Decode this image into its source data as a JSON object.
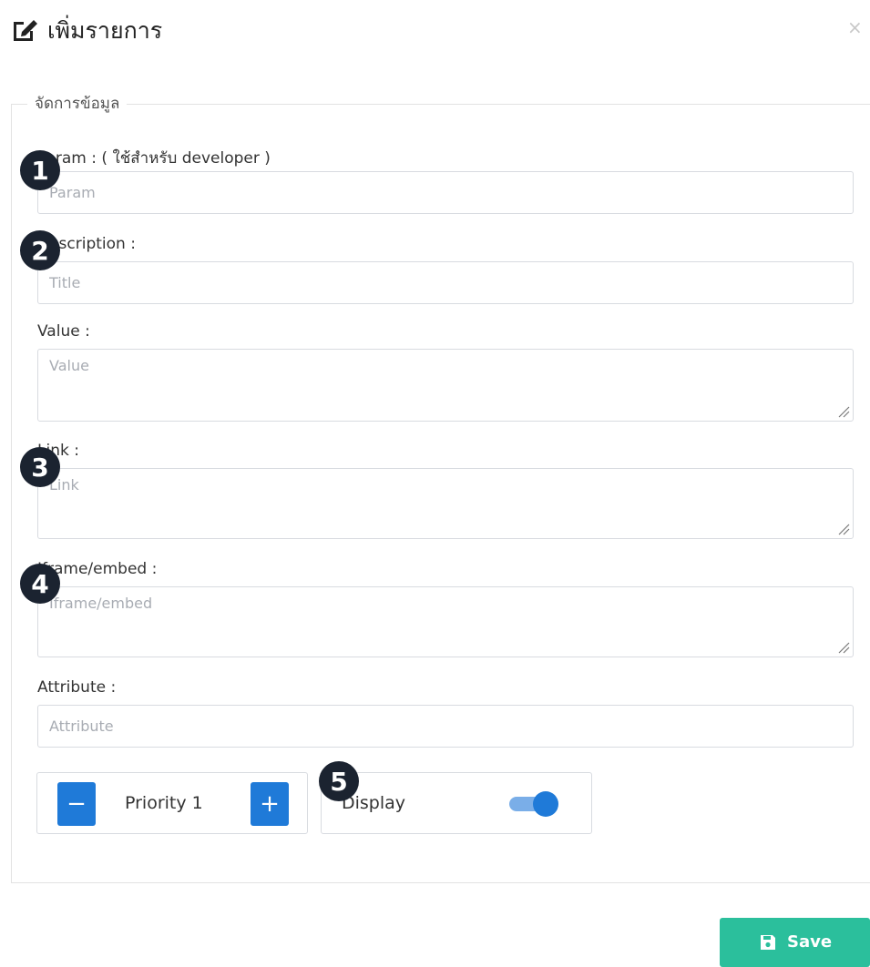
{
  "modal": {
    "title": "เพิ่มรายการ",
    "close": "×"
  },
  "fieldset": {
    "legend": "จัดการข้อมูล"
  },
  "fields": {
    "param": {
      "label": "Param : ( ใช้สำหรับ developer )",
      "placeholder": "Param",
      "value": ""
    },
    "description": {
      "label": "Description :",
      "placeholder": "Title",
      "value": ""
    },
    "value": {
      "label": "Value :",
      "placeholder": "Value",
      "value": ""
    },
    "link": {
      "label": "Link :",
      "placeholder": "Link",
      "value": ""
    },
    "iframe": {
      "label": "Iframe/embed :",
      "placeholder": "Iframe/embed",
      "value": ""
    },
    "attribute": {
      "label": "Attribute :",
      "placeholder": "Attribute",
      "value": ""
    }
  },
  "priority": {
    "minus": "−",
    "label": "Priority 1",
    "plus": "+"
  },
  "display": {
    "label": "Display",
    "enabled": true
  },
  "callouts": [
    "1",
    "2",
    "3",
    "4",
    "5"
  ],
  "footer": {
    "save_label": "Save"
  },
  "colors": {
    "primary": "#1f7ad8",
    "save": "#2bbf9c",
    "callout": "#1b2330"
  },
  "icons": {
    "header": "edit-icon",
    "save": "save-icon"
  }
}
